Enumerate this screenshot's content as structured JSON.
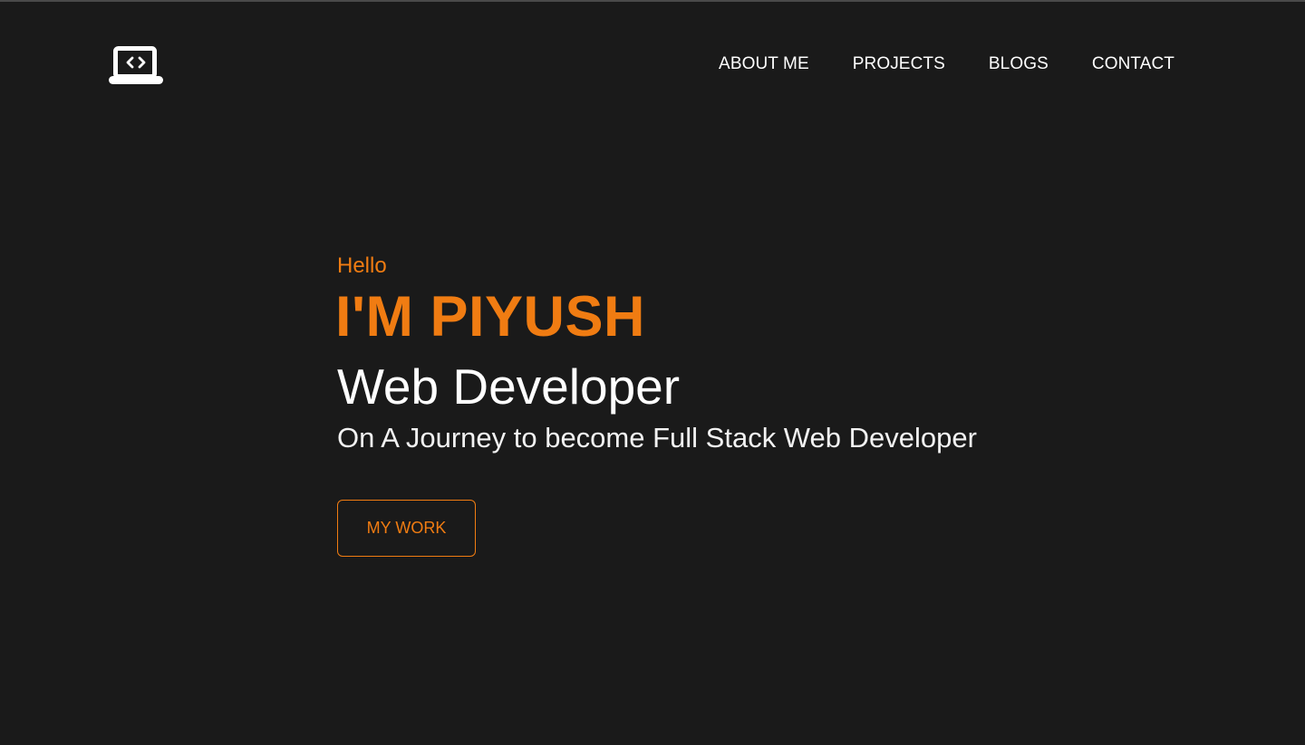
{
  "nav": {
    "logo_icon": "laptop-code-icon",
    "links": [
      {
        "label": "ABOUT ME"
      },
      {
        "label": "PROJECTS"
      },
      {
        "label": "BLOGS"
      },
      {
        "label": "CONTACT"
      }
    ]
  },
  "hero": {
    "greeting": "Hello",
    "name": "I'M PIYUSH",
    "role": "Web Developer",
    "tagline": "On A Journey to become Full Stack Web Developer",
    "button_label": "MY WORK"
  },
  "colors": {
    "background": "#1a1a1a",
    "accent": "#f07c12",
    "text": "#ffffff"
  }
}
